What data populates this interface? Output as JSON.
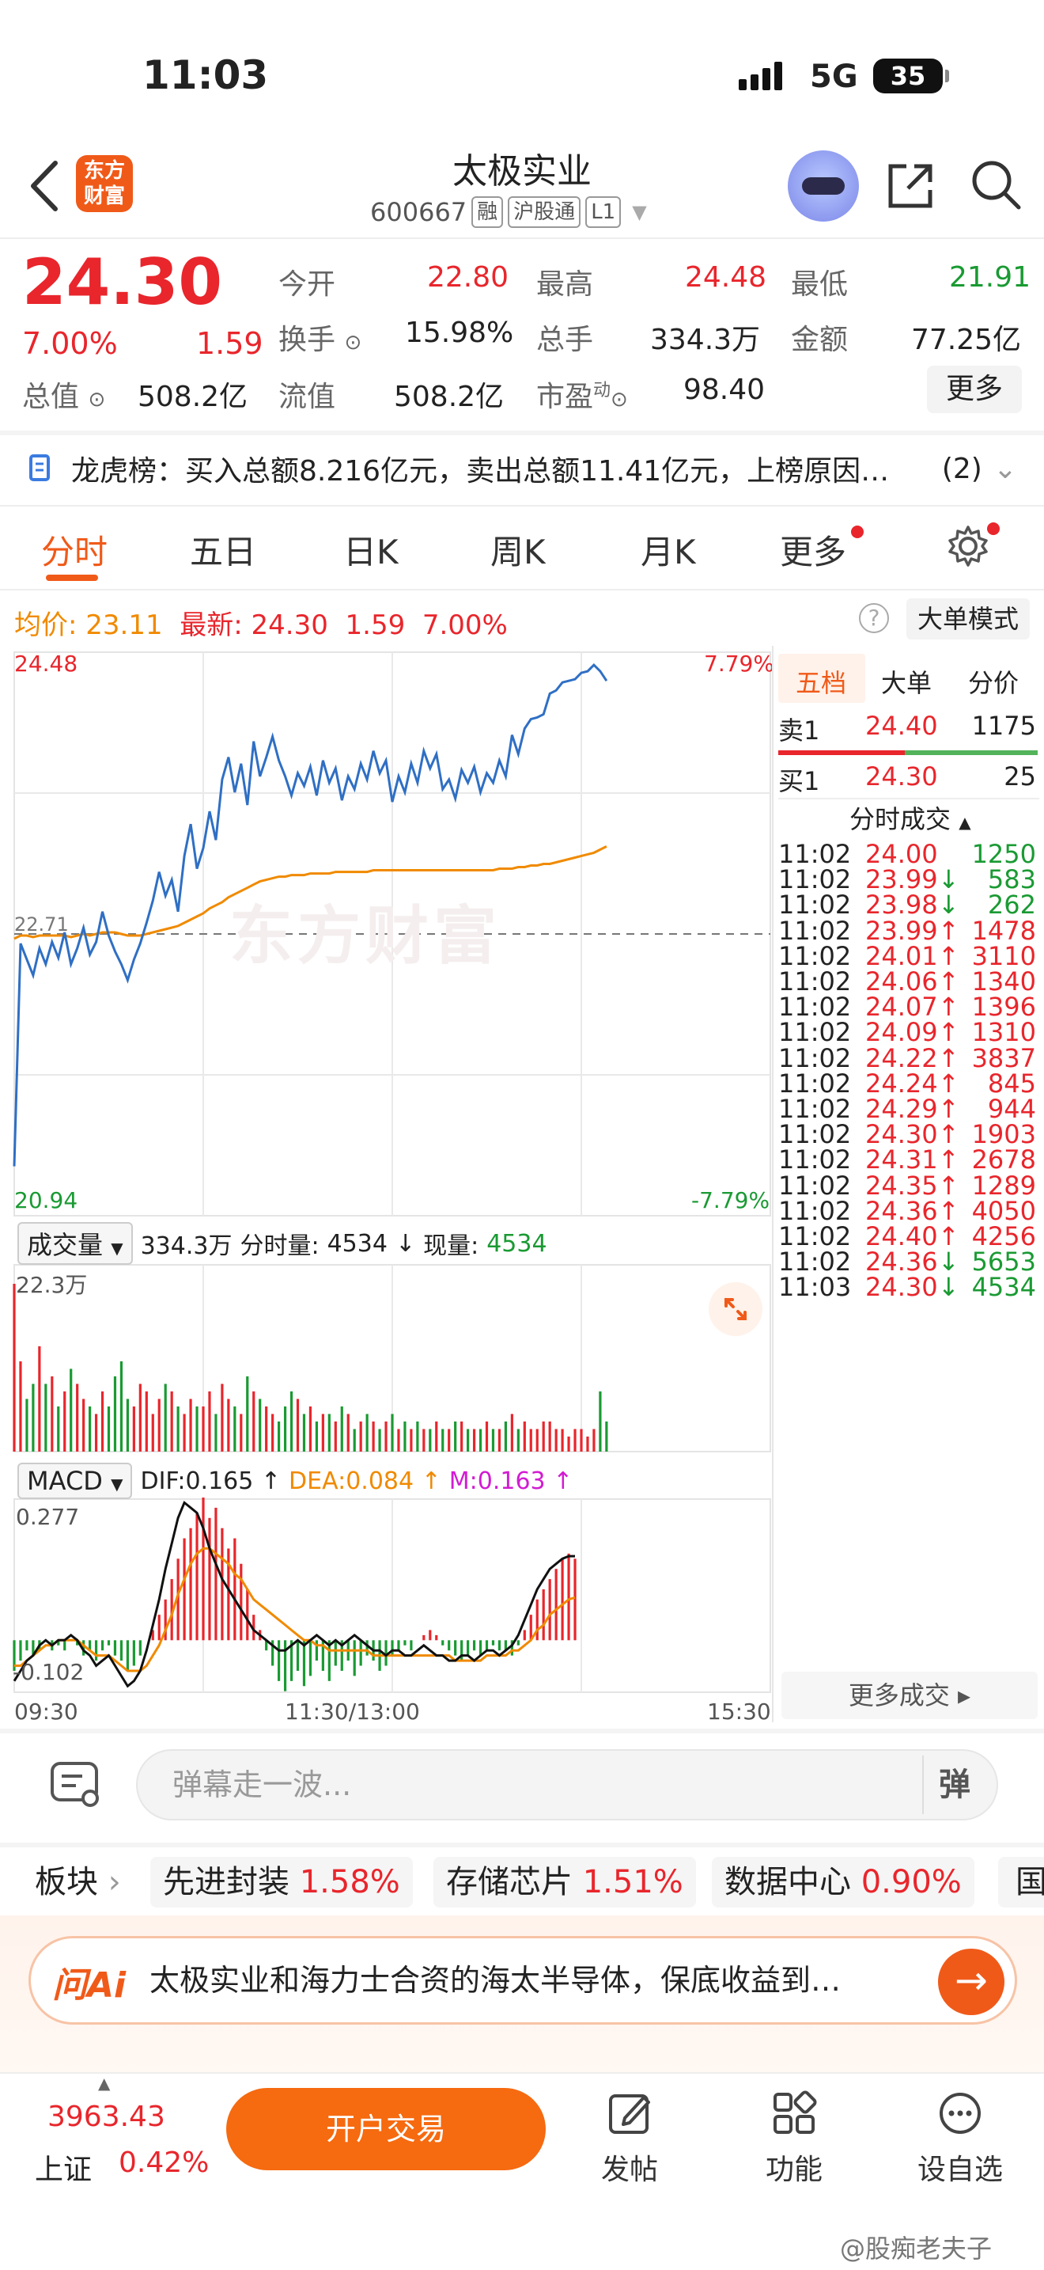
{
  "status": {
    "time": "11:03",
    "network": "5G",
    "battery": "35"
  },
  "header": {
    "back_icon": "back-chevron",
    "logo_text_1": "东方",
    "logo_text_2": "财富",
    "title": "太极实业",
    "code": "600667",
    "tags": [
      "融",
      "沪股通",
      "L1"
    ]
  },
  "quote": {
    "price": "24.30",
    "change_pct": "7.00%",
    "change": "1.59",
    "rows": [
      [
        {
          "label": "今开",
          "value": "22.80",
          "color": "red"
        },
        {
          "label": "最高",
          "value": "24.48",
          "color": "red"
        },
        {
          "label": "最低",
          "value": "21.91",
          "color": "green"
        }
      ],
      [
        {
          "label": "换手",
          "value": "15.98%",
          "color": "dark"
        },
        {
          "label": "总手",
          "value": "334.3万",
          "color": "dark"
        },
        {
          "label": "金额",
          "value": "77.25亿",
          "color": "dark"
        }
      ],
      [
        {
          "label": "总值",
          "value": "508.2亿",
          "color": "dark"
        },
        {
          "label": "流值",
          "value": "508.2亿",
          "color": "dark"
        },
        {
          "label": "市盈",
          "value": "98.40",
          "color": "dark"
        }
      ]
    ],
    "pe_sup": "动",
    "more_label": "更多"
  },
  "longhu": {
    "label": "龙虎榜：",
    "text": "买入总额8.216亿元，卖出总额11.41亿元，上榜原因…",
    "count": "(2)"
  },
  "tabs": [
    "分时",
    "五日",
    "日K",
    "周K",
    "月K",
    "更多"
  ],
  "info": {
    "avg_label": "均价:",
    "avg": "23.11",
    "latest_label": "最新:",
    "latest": "24.30",
    "chg": "1.59",
    "pct": "7.00%",
    "big_mode": "大单模式"
  },
  "chart_data": {
    "type": "line",
    "title": "",
    "y_high": "24.48",
    "y_low": "20.94",
    "pct_high": "7.79%",
    "pct_low": "-7.79%",
    "prev_close_label": "22.71",
    "prev_close": 22.71,
    "ylim": [
      20.94,
      24.48
    ],
    "x_ticks": [
      "09:30",
      "11:30/13:00",
      "15:30"
    ],
    "watermark": "东方财富",
    "series": [
      {
        "values": [
          21.25,
          22.65,
          22.55,
          22.45,
          22.62,
          22.52,
          22.66,
          22.56,
          22.72,
          22.52,
          22.62,
          22.75,
          22.58,
          22.66,
          22.85,
          22.7,
          22.6,
          22.52,
          22.42,
          22.55,
          22.65,
          22.78,
          22.92,
          23.1,
          22.95,
          23.05,
          22.85,
          23.2,
          23.4,
          23.12,
          23.25,
          23.48,
          23.3,
          23.68,
          23.82,
          23.6,
          23.78,
          23.52,
          23.92,
          23.7,
          23.82,
          23.95,
          23.8,
          23.7,
          23.58,
          23.72,
          23.64,
          23.76,
          23.58,
          23.8,
          23.66,
          23.75,
          23.55,
          23.7,
          23.62,
          23.78,
          23.68,
          23.86,
          23.72,
          23.8,
          23.54,
          23.7,
          23.6,
          23.78,
          23.66,
          23.86,
          23.75,
          23.84,
          23.62,
          23.68,
          23.56,
          23.74,
          23.66,
          23.76,
          23.6,
          23.72,
          23.66,
          23.8,
          23.7,
          23.96,
          23.84,
          24.0,
          24.06,
          24.07,
          24.09,
          24.22,
          24.24,
          24.29,
          24.3,
          24.31,
          24.35,
          24.36,
          24.4,
          24.36,
          24.3
        ]
      },
      {
        "values": [
          22.68,
          22.7,
          22.7,
          22.69,
          22.7,
          22.7,
          22.7,
          22.7,
          22.7,
          22.69,
          22.7,
          22.71,
          22.7,
          22.71,
          22.72,
          22.72,
          22.72,
          22.71,
          22.7,
          22.7,
          22.7,
          22.71,
          22.72,
          22.73,
          22.74,
          22.75,
          22.76,
          22.78,
          22.8,
          22.82,
          22.84,
          22.87,
          22.89,
          22.91,
          22.94,
          22.96,
          22.98,
          23.0,
          23.02,
          23.04,
          23.05,
          23.06,
          23.07,
          23.07,
          23.08,
          23.08,
          23.08,
          23.09,
          23.09,
          23.09,
          23.09,
          23.1,
          23.1,
          23.1,
          23.1,
          23.1,
          23.1,
          23.11,
          23.11,
          23.11,
          23.11,
          23.11,
          23.11,
          23.11,
          23.11,
          23.11,
          23.11,
          23.11,
          23.11,
          23.11,
          23.11,
          23.11,
          23.11,
          23.11,
          23.11,
          23.11,
          23.11,
          23.12,
          23.12,
          23.12,
          23.13,
          23.13,
          23.14,
          23.14,
          23.15,
          23.15,
          23.16,
          23.17,
          23.18,
          23.19,
          23.2,
          23.21,
          23.22,
          23.24,
          23.26
        ]
      }
    ],
    "volume": [
      22.3,
      12,
      7,
      9,
      14,
      9,
      10,
      6,
      8,
      11,
      9,
      7,
      6,
      5,
      8,
      6,
      10,
      12,
      7,
      6,
      9,
      8,
      5,
      7,
      9,
      8,
      6,
      5,
      7,
      6,
      6,
      8,
      5,
      9,
      7,
      6,
      5,
      10,
      8,
      7,
      6,
      5,
      4,
      6,
      8,
      7,
      5,
      6,
      4,
      5,
      5,
      4,
      6,
      5,
      3,
      4,
      5,
      4,
      3,
      4,
      5,
      3,
      4,
      3,
      4,
      3,
      3,
      4,
      3,
      3,
      4,
      4,
      3,
      3,
      3,
      4,
      3,
      3,
      4,
      5,
      3,
      4,
      3,
      3,
      4,
      4,
      3,
      3,
      2,
      3,
      3,
      2,
      3,
      8,
      4
    ],
    "volume_ylim": [
      0,
      22.3
    ],
    "macd_hist": [
      -0.06,
      -0.04,
      -0.02,
      -0.03,
      -0.02,
      0.0,
      -0.02,
      -0.01,
      -0.02,
      0.0,
      -0.01,
      -0.03,
      -0.02,
      -0.04,
      -0.02,
      -0.01,
      -0.03,
      -0.04,
      -0.06,
      -0.05,
      -0.03,
      0.0,
      0.02,
      0.05,
      0.08,
      0.12,
      0.16,
      0.2,
      0.22,
      0.25,
      0.28,
      0.24,
      0.26,
      0.22,
      0.18,
      0.2,
      0.15,
      0.1,
      0.05,
      0.02,
      -0.02,
      -0.05,
      -0.08,
      -0.1,
      -0.08,
      -0.06,
      -0.09,
      -0.07,
      -0.04,
      -0.06,
      -0.08,
      -0.05,
      -0.06,
      -0.04,
      -0.07,
      -0.05,
      -0.03,
      -0.04,
      -0.06,
      -0.05,
      -0.03,
      -0.02,
      -0.01,
      -0.02,
      0.0,
      0.01,
      0.02,
      0.01,
      -0.01,
      -0.02,
      -0.03,
      -0.04,
      -0.03,
      -0.02,
      -0.03,
      -0.02,
      -0.01,
      -0.02,
      -0.02,
      -0.03,
      -0.01,
      0.02,
      0.05,
      0.08,
      0.1,
      0.12,
      0.14,
      0.16,
      0.17,
      0.16
    ],
    "macd_dif": [
      -0.08,
      -0.06,
      -0.04,
      -0.03,
      -0.01,
      0.0,
      -0.01,
      0.0,
      0.0,
      0.01,
      0.0,
      -0.02,
      -0.03,
      -0.05,
      -0.04,
      -0.03,
      -0.05,
      -0.07,
      -0.09,
      -0.08,
      -0.06,
      -0.02,
      0.03,
      0.08,
      0.14,
      0.19,
      0.24,
      0.27,
      0.26,
      0.25,
      0.22,
      0.18,
      0.15,
      0.12,
      0.1,
      0.08,
      0.06,
      0.04,
      0.02,
      0.01,
      0.0,
      -0.01,
      -0.02,
      -0.02,
      -0.01,
      0.0,
      -0.01,
      0.0,
      0.01,
      0.0,
      -0.01,
      0.0,
      -0.01,
      0.0,
      0.01,
      0.0,
      -0.01,
      -0.02,
      -0.02,
      -0.03,
      -0.02,
      -0.02,
      -0.03,
      -0.03,
      -0.02,
      -0.01,
      -0.02,
      -0.03,
      -0.03,
      -0.04,
      -0.04,
      -0.03,
      -0.03,
      -0.04,
      -0.03,
      -0.02,
      -0.02,
      -0.03,
      -0.02,
      -0.01,
      0.01,
      0.04,
      0.07,
      0.1,
      0.12,
      0.14,
      0.15,
      0.16,
      0.165,
      0.165
    ],
    "macd_dea": [
      -0.05,
      -0.05,
      -0.04,
      -0.03,
      -0.02,
      -0.01,
      -0.01,
      0.0,
      0.0,
      0.0,
      0.0,
      -0.01,
      -0.02,
      -0.03,
      -0.03,
      -0.03,
      -0.04,
      -0.05,
      -0.06,
      -0.06,
      -0.06,
      -0.05,
      -0.03,
      -0.01,
      0.02,
      0.05,
      0.09,
      0.12,
      0.15,
      0.17,
      0.18,
      0.18,
      0.17,
      0.16,
      0.15,
      0.13,
      0.12,
      0.1,
      0.08,
      0.07,
      0.06,
      0.05,
      0.04,
      0.03,
      0.02,
      0.01,
      0.0,
      0.0,
      -0.01,
      -0.01,
      -0.02,
      -0.02,
      -0.02,
      -0.02,
      -0.02,
      -0.02,
      -0.02,
      -0.03,
      -0.03,
      -0.03,
      -0.03,
      -0.03,
      -0.03,
      -0.03,
      -0.03,
      -0.03,
      -0.03,
      -0.03,
      -0.03,
      -0.03,
      -0.04,
      -0.04,
      -0.04,
      -0.04,
      -0.04,
      -0.03,
      -0.03,
      -0.03,
      -0.03,
      -0.02,
      -0.02,
      -0.01,
      0.0,
      0.02,
      0.03,
      0.05,
      0.06,
      0.07,
      0.08,
      0.084
    ],
    "macd_ylim": [
      -0.102,
      0.277
    ]
  },
  "volume_panel": {
    "select": "成交量",
    "total": "334.3万",
    "fs_label": "分时量:",
    "fs_value": "4534",
    "arrow": "↓",
    "now_label": "现量:",
    "now_value": "4534",
    "max_label": "22.3万"
  },
  "macd_panel": {
    "select": "MACD",
    "dif": "DIF:0.165 ↑",
    "dea": "DEA:0.084 ↑",
    "m": "M:0.163 ↑",
    "top": "0.277",
    "bottom": "-0.102"
  },
  "right_panel": {
    "tabs": [
      "五档",
      "大单",
      "分价"
    ],
    "sell": {
      "label": "卖1",
      "price": "24.40",
      "vol": "1175"
    },
    "buy": {
      "label": "买1",
      "price": "24.30",
      "vol": "25"
    },
    "ticks_title": "分时成交",
    "ticks": [
      {
        "t": "11:02",
        "p": "24.00",
        "a": "",
        "v": "1250",
        "vc": "green"
      },
      {
        "t": "11:02",
        "p": "23.99",
        "a": "↓",
        "v": "583",
        "vc": "green"
      },
      {
        "t": "11:02",
        "p": "23.98",
        "a": "↓",
        "v": "262",
        "vc": "green"
      },
      {
        "t": "11:02",
        "p": "23.99",
        "a": "↑",
        "v": "1478",
        "vc": "red"
      },
      {
        "t": "11:02",
        "p": "24.01",
        "a": "↑",
        "v": "3110",
        "vc": "red"
      },
      {
        "t": "11:02",
        "p": "24.06",
        "a": "↑",
        "v": "1340",
        "vc": "red"
      },
      {
        "t": "11:02",
        "p": "24.07",
        "a": "↑",
        "v": "1396",
        "vc": "red"
      },
      {
        "t": "11:02",
        "p": "24.09",
        "a": "↑",
        "v": "1310",
        "vc": "red"
      },
      {
        "t": "11:02",
        "p": "24.22",
        "a": "↑",
        "v": "3837",
        "vc": "red"
      },
      {
        "t": "11:02",
        "p": "24.24",
        "a": "↑",
        "v": "845",
        "vc": "red"
      },
      {
        "t": "11:02",
        "p": "24.29",
        "a": "↑",
        "v": "944",
        "vc": "red"
      },
      {
        "t": "11:02",
        "p": "24.30",
        "a": "↑",
        "v": "1903",
        "vc": "red"
      },
      {
        "t": "11:02",
        "p": "24.31",
        "a": "↑",
        "v": "2678",
        "vc": "red"
      },
      {
        "t": "11:02",
        "p": "24.35",
        "a": "↑",
        "v": "1289",
        "vc": "red"
      },
      {
        "t": "11:02",
        "p": "24.36",
        "a": "↑",
        "v": "4050",
        "vc": "red"
      },
      {
        "t": "11:02",
        "p": "24.40",
        "a": "↑",
        "v": "4256",
        "vc": "red"
      },
      {
        "t": "11:02",
        "p": "24.36",
        "a": "↓",
        "v": "5653",
        "vc": "green"
      },
      {
        "t": "11:03",
        "p": "24.30",
        "a": "↓",
        "v": "4534",
        "vc": "green"
      }
    ],
    "more_ticks": "更多成交 ▸"
  },
  "barrage": {
    "placeholder": "弹幕走一波...",
    "btn": "弹"
  },
  "sectors": {
    "label": "板块",
    "items": [
      {
        "name": "先进封装",
        "pct": "1.58%"
      },
      {
        "name": "存储芯片",
        "pct": "1.51%"
      },
      {
        "name": "数据中心",
        "pct": "0.90%"
      },
      {
        "name": "国",
        "pct": ""
      }
    ]
  },
  "ai": {
    "logo": "问Ai",
    "text": "太极实业和海力士合资的海太半导体，保底收益到…"
  },
  "bottom": {
    "index_value": "3963.43",
    "index_name": "上证",
    "index_pct": "0.42%",
    "trade_btn": "开户交易",
    "nav": [
      "发帖",
      "功能",
      "设自选"
    ],
    "watermark": "@股痴老夫子"
  },
  "colors": {
    "red": "#e8262c",
    "green": "#1a9a33",
    "orange": "#f08a00",
    "blue": "#2f6fc4",
    "brand": "#f05a19"
  }
}
